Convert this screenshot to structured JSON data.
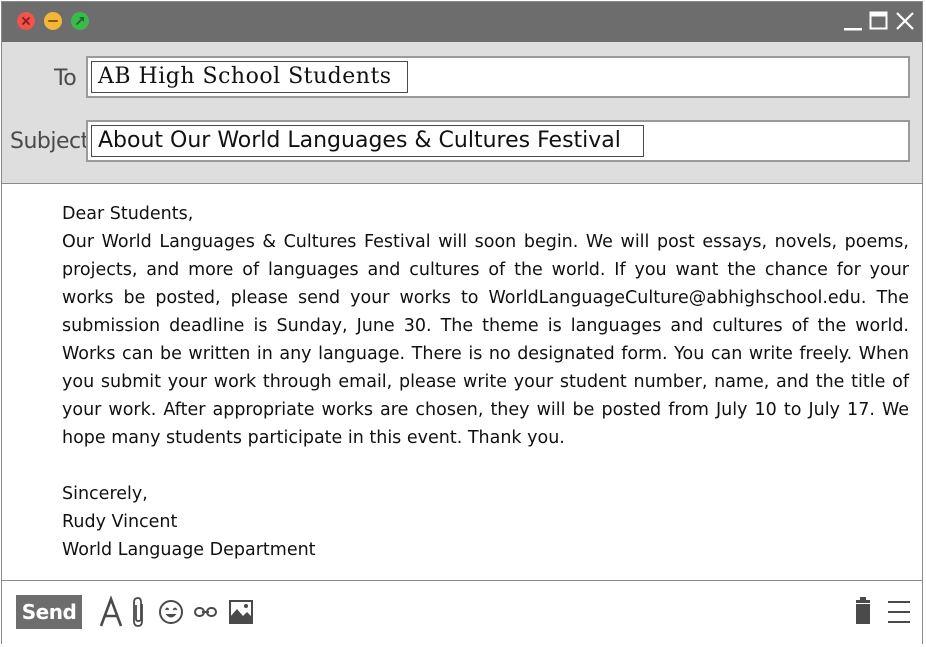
{
  "window": {
    "traffic_lights": [
      {
        "name": "close",
        "color": "#f0534a"
      },
      {
        "name": "minimize",
        "color": "#f4b637"
      },
      {
        "name": "maximize",
        "color": "#3cb94b"
      }
    ],
    "controls": [
      "minimize-icon",
      "maximize-icon",
      "close-icon"
    ]
  },
  "compose": {
    "to_label": "To",
    "to_value": "AB High School Students",
    "subject_label": "Subject",
    "subject_value": "About Our World Languages & Cultures Festival"
  },
  "message": {
    "greeting": "Dear Students,",
    "paragraph": "Our World Languages & Cultures Festival will soon begin. We will post essays, novels, poems, projects, and more of languages and cultures of the world. If you want the chance for your works be posted, please send your works to WorldLanguageCulture@abhighschool.edu. The submission deadline is Sunday, June 30. The theme is languages and cultures of the world. Works can be written in any language. There is no designated form. You can write freely. When you submit your work through email, please write your student number, name, and the title of your work. After appropriate works are chosen, they will be posted from July 10 to July 17. We hope many students participate in this event. Thank you.",
    "closing": "Sincerely,",
    "sender_name": "Rudy Vincent",
    "sender_department": "World Language Department"
  },
  "toolbar": {
    "send_label": "Send",
    "icons": [
      "font-icon",
      "attachment-icon",
      "emoji-icon",
      "link-icon",
      "image-icon",
      "trash-icon",
      "menu-icon"
    ]
  },
  "colors": {
    "titlebar": "#6d6d6d",
    "header_bg": "#dedede",
    "send_button": "#6d6d6d"
  }
}
